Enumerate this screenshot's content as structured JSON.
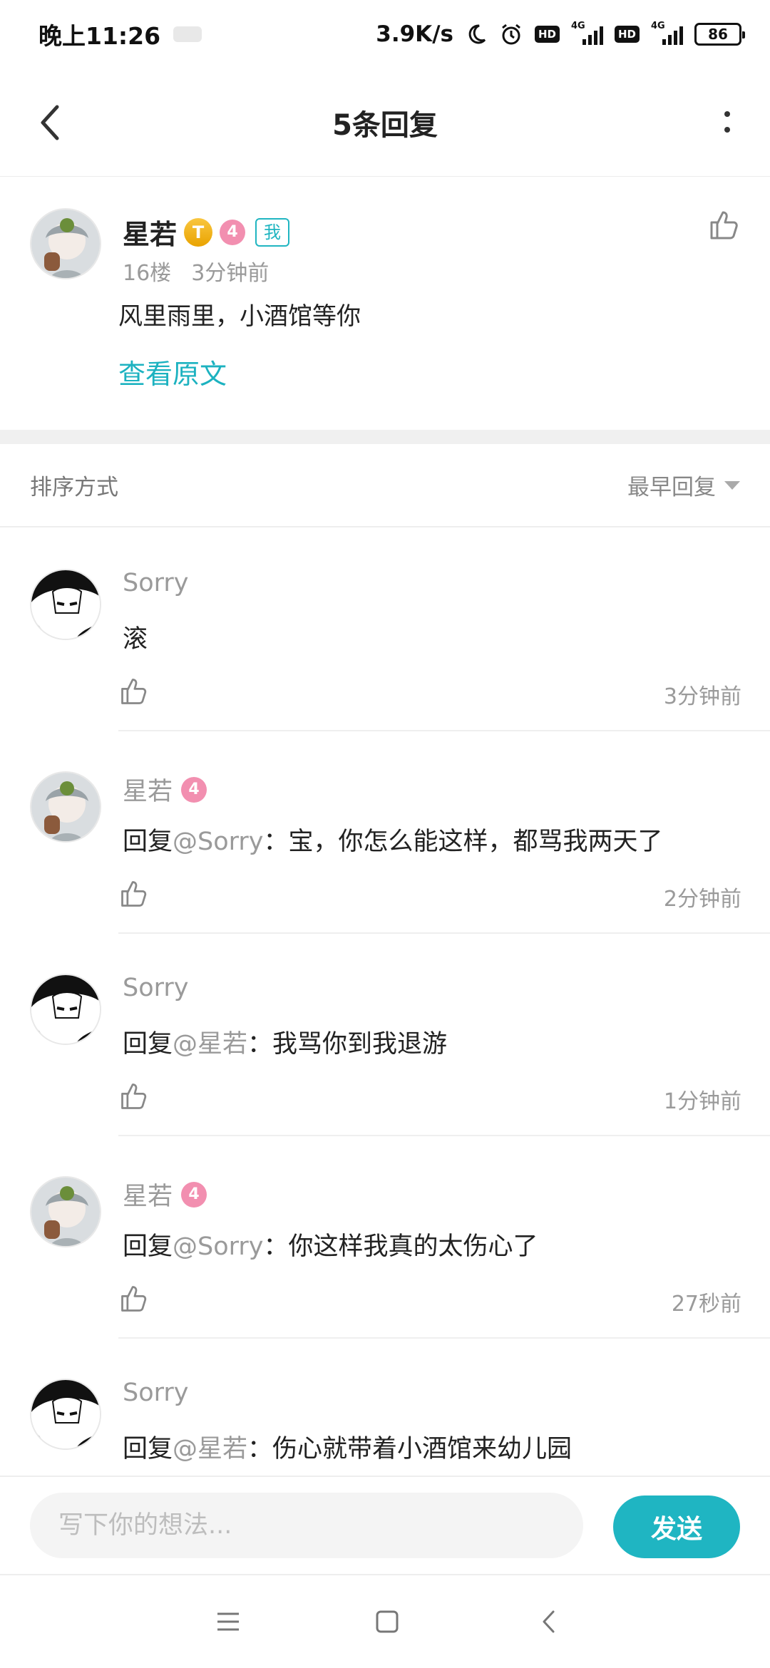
{
  "status_bar": {
    "time": "晚上11:26",
    "speed": "3.9K/s",
    "hd1": "HD",
    "net1": "4G",
    "hd2": "HD",
    "net2": "4G",
    "battery": "86"
  },
  "header": {
    "title": "5条回复",
    "icons": [
      "back-arrow",
      "more-vertical"
    ]
  },
  "original": {
    "user": "星若",
    "badge_t": "T",
    "level": "4",
    "me_tag": "我",
    "floor": "16楼",
    "time": "3分钟前",
    "text": "风里雨里，小酒馆等你",
    "view_original": "查看原文"
  },
  "sort": {
    "label": "排序方式",
    "value": "最早回复"
  },
  "replies": [
    {
      "user": "Sorry",
      "level": "",
      "prefix": "",
      "at": "",
      "text": "滚",
      "time": "3分钟前"
    },
    {
      "user": "星若",
      "level": "4",
      "prefix": "回复",
      "at": "@Sorry",
      "text": "：宝，你怎么能这样，都骂我两天了",
      "time": "2分钟前"
    },
    {
      "user": "Sorry",
      "level": "",
      "prefix": "回复",
      "at": "@星若",
      "text": "：我骂你到我退游",
      "time": "1分钟前"
    },
    {
      "user": "星若",
      "level": "4",
      "prefix": "回复",
      "at": "@Sorry",
      "text": "：你这样我真的太伤心了",
      "time": "27秒前"
    },
    {
      "user": "Sorry",
      "level": "",
      "prefix": "回复",
      "at": "@星若",
      "text": "：伤心就带着小酒馆来幼儿园",
      "time": ""
    }
  ],
  "input": {
    "placeholder": "写下你的想法...",
    "send_label": "发送"
  },
  "colors": {
    "accent": "#1fb5c2",
    "level_pink": "#f28fb0",
    "badge_gold": "#f0b21a"
  }
}
